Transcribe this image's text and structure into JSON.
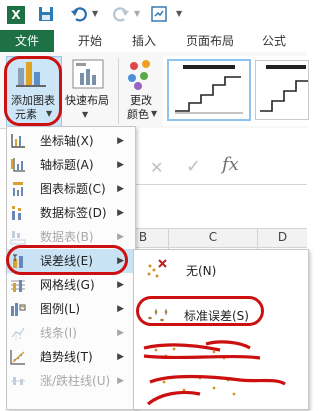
{
  "titlebar": {
    "app_icon_letter": "X",
    "undo_icon": "undo-arrow",
    "redo_icon": "redo-arrow"
  },
  "ribbon_tabs": {
    "file": "文件",
    "tabs": [
      "开始",
      "插入",
      "页面布局",
      "公式"
    ]
  },
  "ribbon": {
    "add_chart_element": [
      "添加图表",
      "元素"
    ],
    "quick_layout": "快速布局",
    "change_colors": [
      "更改",
      "颜色"
    ],
    "name_box_glyphs": {
      "cancel": "✕",
      "enter": "✓",
      "fx": "fx"
    }
  },
  "grid": {
    "columns": [
      "B",
      "C",
      "D"
    ]
  },
  "menu": {
    "items": [
      {
        "label": "坐标轴(X)",
        "disabled": false
      },
      {
        "label": "轴标题(A)",
        "disabled": false
      },
      {
        "label": "图表标题(C)",
        "disabled": false
      },
      {
        "label": "数据标签(D)",
        "disabled": false
      },
      {
        "label": "数据表(B)",
        "disabled": true
      },
      {
        "label": "误差线(E)",
        "disabled": false,
        "highlighted": true
      },
      {
        "label": "网格线(G)",
        "disabled": false
      },
      {
        "label": "图例(L)",
        "disabled": false
      },
      {
        "label": "线条(I)",
        "disabled": true
      },
      {
        "label": "趋势线(T)",
        "disabled": false
      },
      {
        "label": "涨/跌柱线(U)",
        "disabled": true
      }
    ]
  },
  "submenu": {
    "none_label": "无(N)",
    "standard_error_label": "标准误差(S)"
  },
  "colors": {
    "excel_green": "#1e7145",
    "highlight": "#c9e3f5",
    "annotation_red": "#cc1010"
  }
}
